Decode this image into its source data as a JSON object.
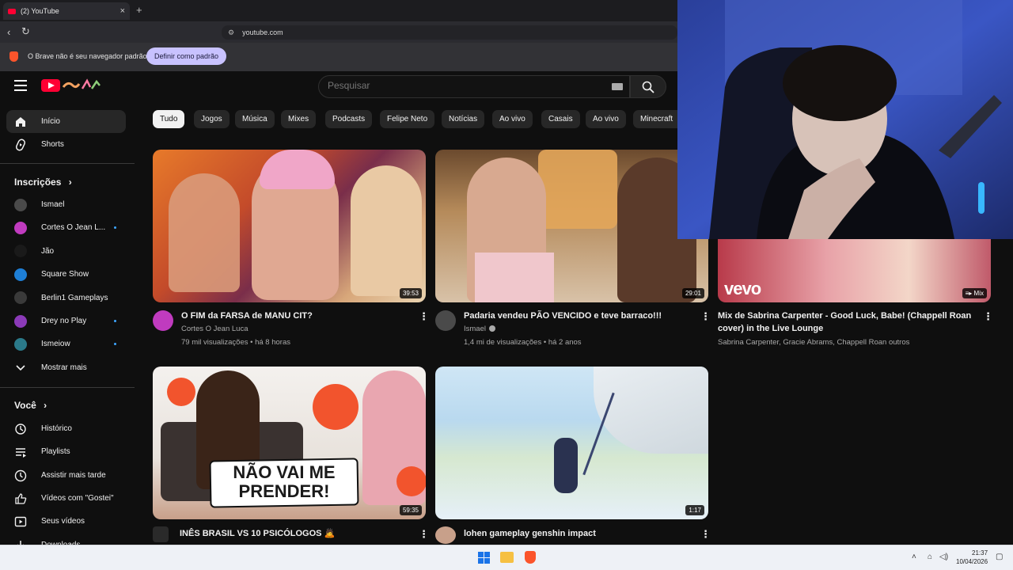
{
  "browser": {
    "tab_title": "(2) YouTube",
    "tab_close": "×",
    "new_tab": "+",
    "url": "youtube.com",
    "infobar_text": "O Brave não é seu navegador padrão",
    "infobar_button": "Definir como padrão"
  },
  "header": {
    "search_placeholder": "Pesquisar"
  },
  "sidebar": {
    "main": [
      {
        "label": "Início",
        "icon": "home-icon",
        "active": true
      },
      {
        "label": "Shorts",
        "icon": "shorts-icon"
      }
    ],
    "subscriptions_title": "Inscrições",
    "subscriptions": [
      {
        "label": "Ismael",
        "color": "#4a4a4a",
        "dot": false
      },
      {
        "label": "Cortes O Jean L...",
        "color": "#c03bbf",
        "dot": true
      },
      {
        "label": "Jão",
        "color": "#1a1a1a",
        "dot": false
      },
      {
        "label": "Square Show",
        "color": "#1e7fd6",
        "dot": false
      },
      {
        "label": "Berlin1 Gameplays",
        "color": "#3a3a3a",
        "dot": false
      },
      {
        "label": "Drey no Play",
        "color": "#8b3ab8",
        "dot": true
      },
      {
        "label": "Ismeiow",
        "color": "#2b7a8a",
        "dot": true
      }
    ],
    "show_more": "Mostrar mais",
    "you_title": "Você",
    "you_items": [
      {
        "label": "Histórico",
        "icon": "history-icon"
      },
      {
        "label": "Playlists",
        "icon": "playlists-icon"
      },
      {
        "label": "Assistir mais tarde",
        "icon": "watch-later-icon"
      },
      {
        "label": "Vídeos com \"Gostei\"",
        "icon": "thumbs-up-icon"
      },
      {
        "label": "Seus vídeos",
        "icon": "your-videos-icon"
      },
      {
        "label": "Downloads",
        "icon": "downloads-icon"
      }
    ]
  },
  "chips": [
    "Tudo",
    "Jogos",
    "Música",
    "Mixes",
    "Podcasts",
    "Felipe Neto",
    "Notícias",
    "Ao vivo",
    "Casais",
    "Ao vivo",
    "Minecraft"
  ],
  "videos": [
    {
      "title": "O FIM da FARSA de MANU CIT?",
      "channel": "Cortes O Jean Luca",
      "views": "79 mil visualizações",
      "age": "há 8 horas",
      "duration": "39:53"
    },
    {
      "title": "Padaria vendeu PÃO VENCIDO e teve barraco!!!",
      "channel": "Ismael",
      "views": "1,4 mi de visualizações",
      "age": "há 2 anos",
      "duration": "29:01"
    },
    {
      "title": "Mix de Sabrina Carpenter - Good Luck, Babe! (Chappell Roan cover) in the Live Lounge",
      "channel": "Sabrina Carpenter, Gracie Abrams, Chappell Roan outros",
      "badge": "Mix",
      "brand": "vevo"
    },
    {
      "title": "INÊS BRASIL VS 10 PSICÓLOGOS 🙇",
      "channel": "",
      "duration": "59:35",
      "overlay_text_1": "NÃO VAI ME",
      "overlay_text_2": "PRENDER!"
    },
    {
      "title": "lohen gameplay genshin impact",
      "channel": "",
      "duration": "1:17"
    }
  ],
  "taskbar": {
    "time": "21:37",
    "date": "10/04/2026"
  }
}
